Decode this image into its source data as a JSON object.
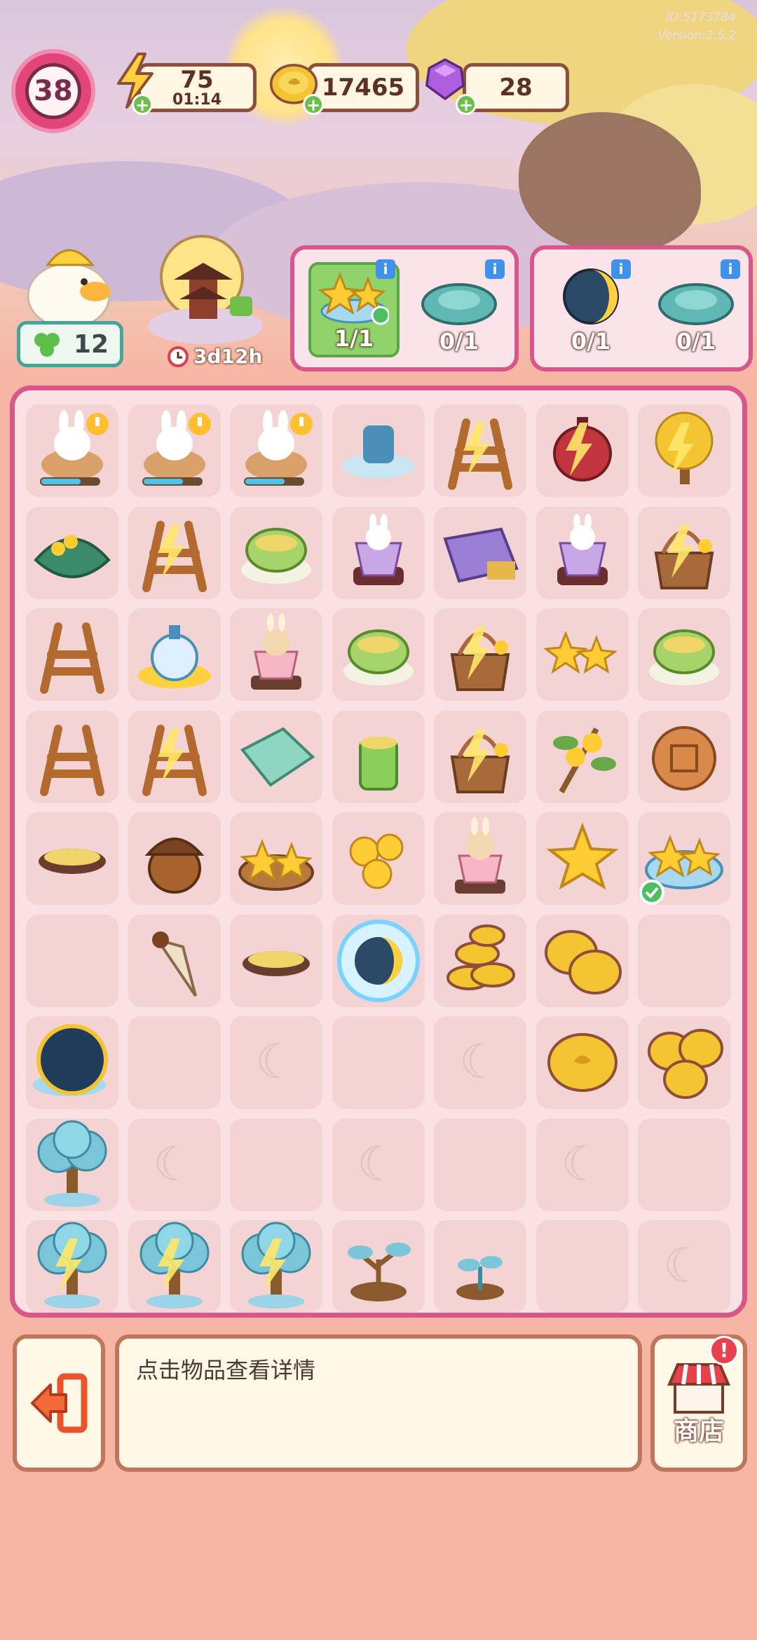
{
  "header": {
    "id_text": "ID:5173784",
    "version_text": "Version:2.5.2",
    "level": "38",
    "energy": {
      "value": "75",
      "timer": "01:14",
      "icon": "lightning-icon"
    },
    "coins": {
      "value": "17465",
      "icon": "coin-icon"
    },
    "gems": {
      "value": "28",
      "icon": "gem-icon"
    }
  },
  "helper": {
    "count": "12",
    "icon": "clover-icon"
  },
  "event": {
    "timer": "3d12h",
    "icon": "clock-icon"
  },
  "orders": [
    {
      "slots": [
        {
          "item": "star-fruit-plate",
          "count": "1/1",
          "done": true
        },
        {
          "item": "teal-pond",
          "count": "0/1",
          "done": false
        }
      ]
    },
    {
      "slots": [
        {
          "item": "crescent-moon",
          "count": "0/1",
          "done": false
        },
        {
          "item": "teal-pond",
          "count": "0/1",
          "done": false
        }
      ]
    }
  ],
  "board": {
    "rows": [
      [
        "bunny-worker-1",
        "bunny-worker-2",
        "bunny-worker-3",
        "lantern-cloud",
        "wood-rack-charged",
        "red-lantern-charged",
        "golden-tree-charged"
      ],
      [
        "osmanthus-leaf",
        "wood-rack-charged",
        "green-bowl",
        "bunny-cup",
        "purple-cloth",
        "bunny-cup",
        "osmanthus-basket-charged"
      ],
      [
        "wood-rack",
        "blue-potion",
        "bunny-pudding",
        "green-bowl",
        "osmanthus-basket-charged",
        "twin-stars",
        "green-bowl"
      ],
      [
        "wood-rack",
        "wood-rack-charged",
        "teal-cloth",
        "green-cup",
        "osmanthus-basket-charged",
        "osmanthus-branch",
        "mooncake"
      ],
      [
        "small-dish",
        "acorn",
        "star-basket",
        "osmanthus-flowers",
        "bunny-pudding",
        "yellow-flower",
        "star-fruit-plate-check"
      ],
      [
        "empty",
        "shell-cone",
        "small-dish",
        "moon-bubble",
        "coin-stack",
        "coin-pair",
        "empty"
      ],
      [
        "thunder-moon",
        "empty",
        "locked",
        "empty",
        "locked",
        "coin",
        "coin-triple"
      ],
      [
        "blue-tree",
        "locked",
        "empty",
        "locked",
        "empty",
        "locked",
        "empty"
      ],
      [
        "blue-tree-charged",
        "blue-tree-charged",
        "blue-tree-charged",
        "blue-sapling",
        "blue-sprout",
        "empty",
        "locked"
      ]
    ]
  },
  "bottom": {
    "hint": "点击物品查看详情",
    "shop_label": "商店",
    "shop_alert": "!",
    "exit_icon": "exit-icon"
  },
  "colors": {
    "board_border": "#d8568a",
    "panel_border": "#c0765b",
    "level_ring": "#e2457a"
  }
}
